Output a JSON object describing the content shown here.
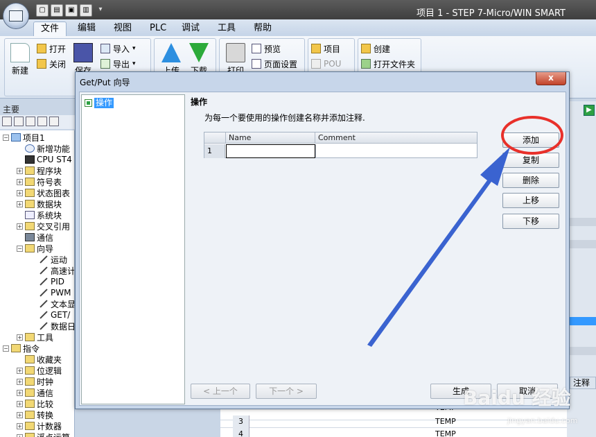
{
  "window": {
    "title": "项目 1 - STEP 7-Micro/WIN SMART"
  },
  "menu": {
    "tabs": [
      "文件",
      "编辑",
      "视图",
      "PLC",
      "调试",
      "工具",
      "帮助"
    ],
    "active": "文件"
  },
  "ribbon": {
    "new": "新建",
    "open": "打开",
    "close": "关闭",
    "save": "保存",
    "import": "导入",
    "export": "导出",
    "upload": "上传",
    "download": "下载",
    "print": "打印",
    "preview": "预览",
    "page_setup": "页面设置",
    "project": "项目",
    "pou": "POU",
    "create": "创建",
    "open_folder": "打开文件夹"
  },
  "nav": {
    "header": "主要",
    "tree": [
      {
        "label": "项目1",
        "level": 0,
        "exp": "−",
        "icon": "proj"
      },
      {
        "label": "新增功能",
        "level": 1,
        "exp": "",
        "icon": "help"
      },
      {
        "label": "CPU ST4",
        "level": 1,
        "exp": "",
        "icon": "cpu"
      },
      {
        "label": "程序块",
        "level": 1,
        "exp": "+",
        "icon": "folder"
      },
      {
        "label": "符号表",
        "level": 1,
        "exp": "+",
        "icon": "folder"
      },
      {
        "label": "状态图表",
        "level": 1,
        "exp": "+",
        "icon": "folder"
      },
      {
        "label": "数据块",
        "level": 1,
        "exp": "+",
        "icon": "folder"
      },
      {
        "label": "系统块",
        "level": 1,
        "exp": "",
        "icon": "sys"
      },
      {
        "label": "交叉引用",
        "level": 1,
        "exp": "+",
        "icon": "folder"
      },
      {
        "label": "通信",
        "level": 1,
        "exp": "",
        "icon": "comm"
      },
      {
        "label": "向导",
        "level": 1,
        "exp": "−",
        "icon": "folder"
      },
      {
        "label": "运动",
        "level": 2,
        "exp": "",
        "icon": "wand"
      },
      {
        "label": "高速计",
        "level": 2,
        "exp": "",
        "icon": "wand"
      },
      {
        "label": "PID",
        "level": 2,
        "exp": "",
        "icon": "wand"
      },
      {
        "label": "PWM",
        "level": 2,
        "exp": "",
        "icon": "wand"
      },
      {
        "label": "文本显",
        "level": 2,
        "exp": "",
        "icon": "wand"
      },
      {
        "label": "GET/",
        "level": 2,
        "exp": "",
        "icon": "wand"
      },
      {
        "label": "数据日",
        "level": 2,
        "exp": "",
        "icon": "wand"
      },
      {
        "label": "工具",
        "level": 1,
        "exp": "+",
        "icon": "folder"
      },
      {
        "label": "指令",
        "level": 0,
        "exp": "−",
        "icon": "folder"
      },
      {
        "label": "收藏夹",
        "level": 1,
        "exp": "",
        "icon": "folder"
      },
      {
        "label": "位逻辑",
        "level": 1,
        "exp": "+",
        "icon": "folder"
      },
      {
        "label": "时钟",
        "level": 1,
        "exp": "+",
        "icon": "folder"
      },
      {
        "label": "通信",
        "level": 1,
        "exp": "+",
        "icon": "folder"
      },
      {
        "label": "比较",
        "level": 1,
        "exp": "+",
        "icon": "folder"
      },
      {
        "label": "转换",
        "level": 1,
        "exp": "+",
        "icon": "folder"
      },
      {
        "label": "计数器",
        "level": 1,
        "exp": "+",
        "icon": "folder"
      },
      {
        "label": "浮点运算",
        "level": 1,
        "exp": "+",
        "icon": "folder"
      }
    ]
  },
  "background": {
    "comment_header": "注释",
    "rows": [
      {
        "num": "3",
        "value": "TEMP"
      },
      {
        "num": "4",
        "value": "TEMP"
      }
    ],
    "partial_value": "TEMP"
  },
  "dialog": {
    "title": "Get/Put 向导",
    "close": "x",
    "step_label": "操作",
    "panel_title": "操作",
    "description": "为每一个要使用的操作创建名称并添加注释.",
    "grid": {
      "col_name": "Name",
      "col_comment": "Comment",
      "row_num": "1",
      "name_value": "",
      "comment_value": ""
    },
    "buttons": {
      "add": "添加",
      "copy": "复制",
      "delete": "删除",
      "move_up": "上移",
      "move_down": "下移"
    },
    "nav": {
      "prev": "< 上一个",
      "next": "下一个 >",
      "generate": "生成",
      "cancel": "取消"
    }
  },
  "watermark": {
    "logo": "Baidu 经验",
    "url": "jingyan.baidu.com"
  },
  "colors": {
    "highlight_circle": "#e8302a",
    "arrow": "#3a63d0",
    "selection": "#3399ff"
  }
}
